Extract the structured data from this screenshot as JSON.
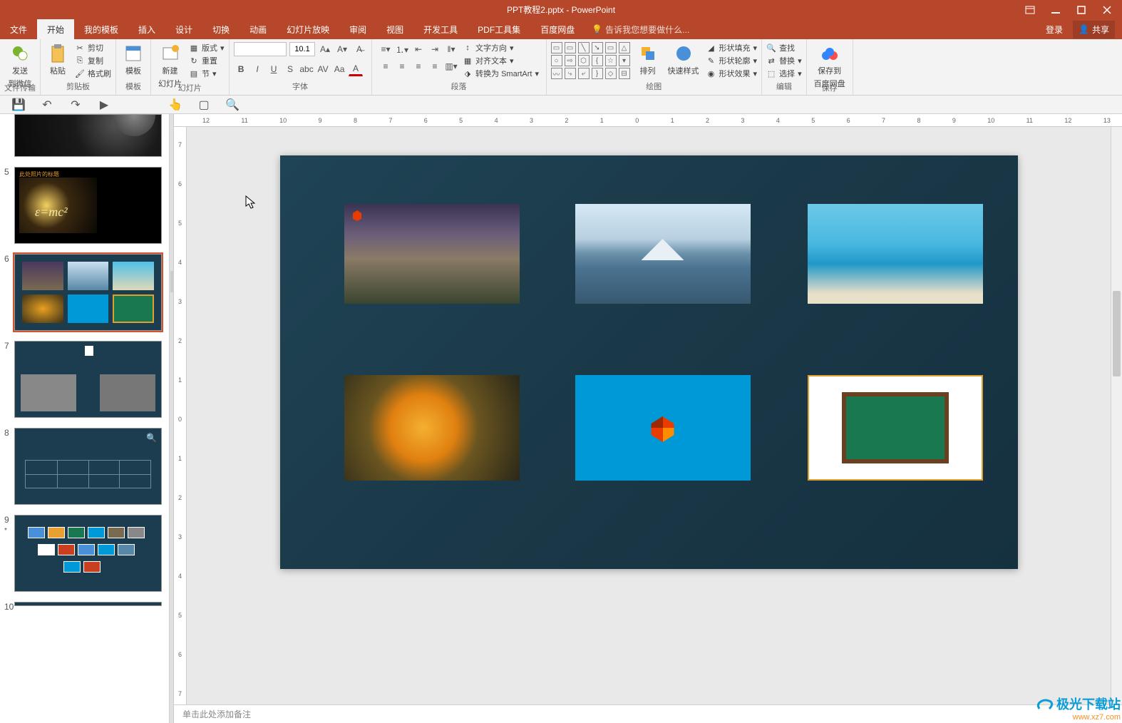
{
  "titlebar": {
    "title": "PPT教程2.pptx - PowerPoint"
  },
  "menu": {
    "file": "文件",
    "home": "开始",
    "mytemplate": "我的模板",
    "insert": "插入",
    "design": "设计",
    "transition": "切换",
    "animation": "动画",
    "slideshow": "幻灯片放映",
    "review": "审阅",
    "view": "视图",
    "developer": "开发工具",
    "pdftools": "PDF工具集",
    "baidu": "百度网盘",
    "tell_me": "告诉我您想要做什么...",
    "login": "登录",
    "share": "共享"
  },
  "ribbon": {
    "wechat": {
      "send": "发送",
      "to": "到微信",
      "group": "文件传输"
    },
    "clipboard": {
      "paste": "粘贴",
      "cut": "剪切",
      "copy": "复制",
      "format": "格式刷",
      "group": "剪贴板"
    },
    "templates": {
      "btn": "模板",
      "group": "模板"
    },
    "slides": {
      "new": "新建",
      "new2": "幻灯片",
      "layout": "版式",
      "reset": "重置",
      "section": "节",
      "group": "幻灯片"
    },
    "font": {
      "size": "10.1",
      "group": "字体"
    },
    "para": {
      "group": "段落",
      "dir": "文字方向",
      "align": "对齐文本",
      "smart": "转换为 SmartArt"
    },
    "draw": {
      "arrange": "排列",
      "quick": "快速样式",
      "fill": "形状填充",
      "outline": "形状轮廓",
      "effect": "形状效果",
      "group": "绘图"
    },
    "edit": {
      "find": "查找",
      "replace": "替换",
      "select": "选择",
      "group": "编辑"
    },
    "save": {
      "l1": "保存到",
      "l2": "百度网盘",
      "group": "保存"
    }
  },
  "thumbs": {
    "n5": "5",
    "n6": "6",
    "n7": "7",
    "n8": "8",
    "n9": "9",
    "n10": "10",
    "star": "*",
    "title5": "此处照片的标题"
  },
  "notes": {
    "placeholder": "单击此处添加备注"
  },
  "ruler_h": [
    "12",
    "11",
    "10",
    "9",
    "8",
    "7",
    "6",
    "5",
    "4",
    "3",
    "2",
    "1",
    "0",
    "1",
    "2",
    "3",
    "4",
    "5",
    "6",
    "7",
    "8",
    "9",
    "10",
    "11",
    "12",
    "13"
  ],
  "ruler_v": [
    "7",
    "6",
    "5",
    "4",
    "3",
    "2",
    "1",
    "0",
    "1",
    "2",
    "3",
    "4",
    "5",
    "6",
    "7"
  ],
  "watermark": {
    "big": "极光下载站",
    "small": "www.xz7.com"
  }
}
